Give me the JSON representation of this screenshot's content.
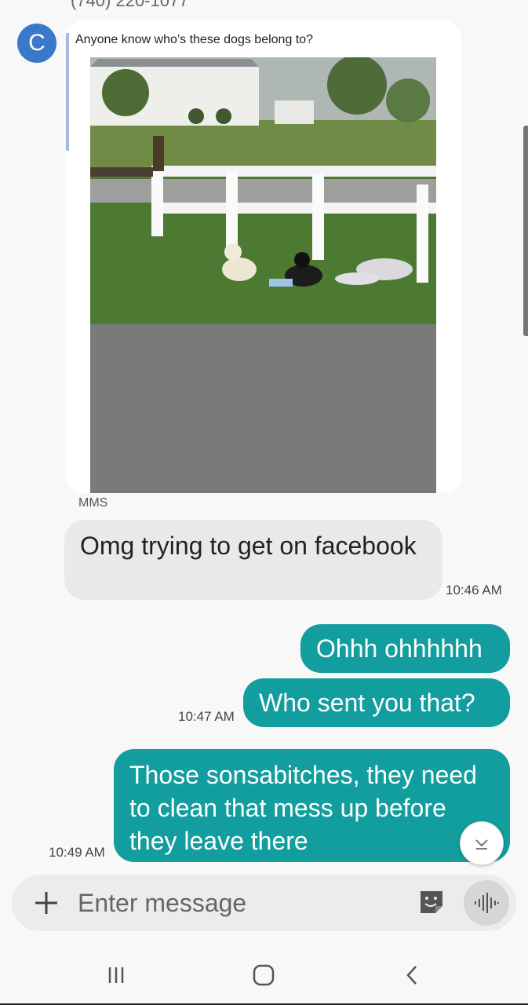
{
  "header": {
    "cut_off_text": "(740) 220-1077"
  },
  "thread": {
    "contact_initial": "C",
    "incoming_mms": {
      "quote_text": "Anyone know who’s these dogs belong to?",
      "type_label": "MMS"
    },
    "incoming_text": {
      "text": "Omg trying to get on facebook",
      "time": "10:46 AM"
    },
    "outgoing": [
      {
        "text": "Ohhh ohhhhhh"
      },
      {
        "text": "Who sent you that?",
        "time": "10:47 AM"
      },
      {
        "text": "Those sonsabitches, they need to clean that mess up before they leave there",
        "time": "10:49 AM"
      }
    ]
  },
  "composer": {
    "placeholder": "Enter message"
  },
  "icons": {
    "add": "plus-icon",
    "sticker": "sticker-icon",
    "voice": "voice-wave-icon",
    "scroll": "chevron-down-icon",
    "nav_recent": "recent-apps-icon",
    "nav_home": "home-icon",
    "nav_back": "back-icon"
  },
  "colors": {
    "accent": "#129e9e",
    "incoming_bubble": "#e9e9e9",
    "avatar": "#3a78c9"
  }
}
